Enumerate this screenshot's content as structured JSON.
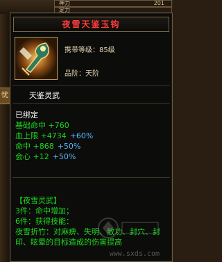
{
  "background": {
    "row1": {
      "label": "神力",
      "value": "201"
    },
    "row2": {
      "label": "定力",
      "value": ""
    },
    "left_tab": "忧"
  },
  "tooltip": {
    "title": "夜雪天鉴玉钩",
    "required_level_label": "携带等级：85级",
    "grade_label": "品阶：天阶",
    "subname": "天鉴灵武",
    "bound": "已绑定",
    "stats": [
      {
        "text": "基础命中 +760",
        "bonus": ""
      },
      {
        "text": "血上限 +4734",
        "bonus": "+60%"
      },
      {
        "text": "命中 +868",
        "bonus": "+50%"
      },
      {
        "text": "会心 +12",
        "bonus": "+50%"
      }
    ],
    "set": {
      "name": "【夜雪灵武】",
      "line3": "3件：命中增加；",
      "line6": "6件：获得技能：",
      "skill_desc": "夜雪折竹：对麻痹、失明、散功、封穴、封印、眩晕的目标造成的伤害提高"
    }
  },
  "watermark": {
    "site": "www.sxds.com"
  },
  "colors": {
    "title_red": "#ff3b3b",
    "stat_green": "#1ed61e",
    "bonus_blue": "#57b9ff"
  }
}
